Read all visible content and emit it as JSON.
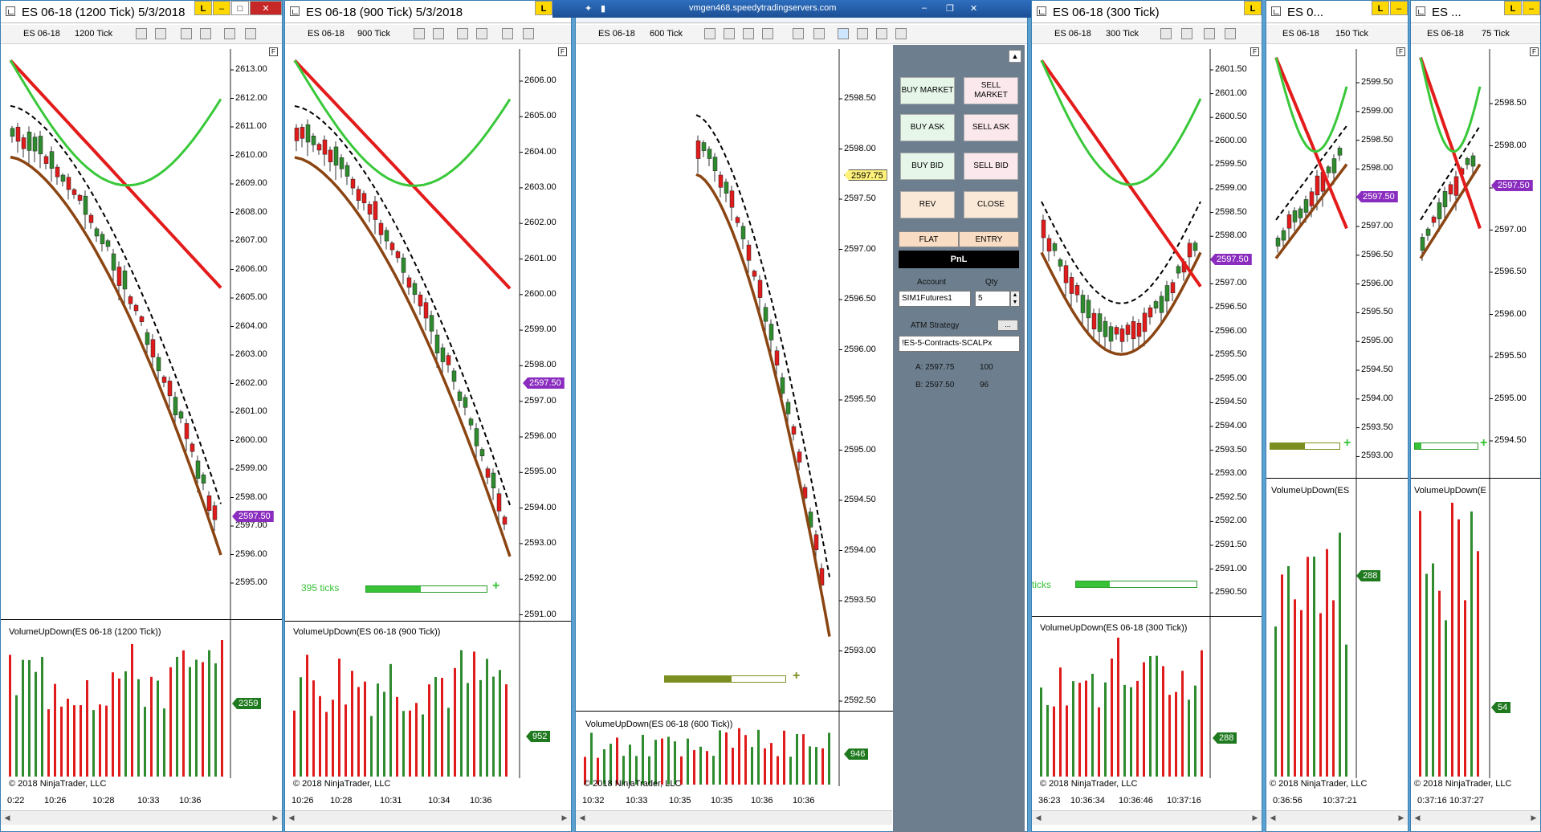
{
  "windows": [
    {
      "id": "w1200",
      "title": "ES 06-18 (1200 Tick)  5/3/2018",
      "instrument": "ES 06-18",
      "interval": "1200 Tick",
      "price_badge": "2597.50",
      "volume_title": "VolumeUpDown(ES 06-18 (1200 Tick))",
      "volume_badge": "2359",
      "copyright": "© 2018 NinjaTrader, LLC",
      "yticks": [
        "2613.00",
        "2612.00",
        "2611.00",
        "2610.00",
        "2609.00",
        "2608.00",
        "2607.00",
        "2606.00",
        "2605.00",
        "2604.00",
        "2603.00",
        "2602.00",
        "2601.00",
        "2600.00",
        "2599.00",
        "2598.00",
        "2597.00",
        "2596.00",
        "2595.00"
      ],
      "xticks": [
        "0:22",
        "10:26",
        "10:28",
        "10:33",
        "10:36"
      ]
    },
    {
      "id": "w900",
      "title": "ES 06-18 (900 Tick)  5/3/2018",
      "instrument": "ES 06-18",
      "interval": "900 Tick",
      "price_badge": "2597.50",
      "volume_title": "VolumeUpDown(ES 06-18 (900 Tick))",
      "volume_badge": "952",
      "copyright": "© 2018 NinjaTrader, LLC",
      "ticks_left": "395 ticks",
      "yticks": [
        "2606.00",
        "2605.00",
        "2604.00",
        "2603.00",
        "2602.00",
        "2601.00",
        "2600.00",
        "2599.00",
        "2598.00",
        "2597.00",
        "2596.00",
        "2595.00",
        "2594.00",
        "2593.00",
        "2592.00",
        "2591.00"
      ],
      "xticks": [
        "10:26",
        "10:28",
        "10:31",
        "10:34",
        "10:36"
      ]
    },
    {
      "id": "w600",
      "title": "",
      "instrument": "ES 06-18",
      "interval": "600 Tick",
      "price_badge": "2597.75",
      "volume_title": "VolumeUpDown(ES 06-18 (600 Tick))",
      "volume_badge": "946",
      "copyright": "© 2018 NinjaTrader, LLC",
      "yticks": [
        "2598.50",
        "2598.00",
        "2597.50",
        "2597.00",
        "2596.50",
        "2596.00",
        "2595.50",
        "2595.00",
        "2594.50",
        "2594.00",
        "2593.50",
        "2593.00",
        "2592.50"
      ],
      "xticks": [
        "10:32",
        "10:33",
        "10:35",
        "10:35",
        "10:36",
        "10:36"
      ]
    },
    {
      "id": "w300",
      "title": "ES 06-18 (300 Tick)",
      "instrument": "ES 06-18",
      "interval": "300 Tick",
      "price_badge": "2597.50",
      "volume_title": "VolumeUpDown(ES 06-18 (300 Tick))",
      "volume_badge": "288",
      "copyright": "© 2018 NinjaTrader, LLC",
      "ticks_left": "ticks",
      "yticks": [
        "2601.50",
        "2601.00",
        "2600.50",
        "2600.00",
        "2599.50",
        "2599.00",
        "2598.50",
        "2598.00",
        "2597.50",
        "2597.00",
        "2596.50",
        "2596.00",
        "2595.50",
        "2595.00",
        "2594.50",
        "2594.00",
        "2593.50",
        "2593.00",
        "2592.50",
        "2592.00",
        "2591.50",
        "2591.00",
        "2590.50"
      ],
      "xticks": [
        "36:23",
        "10:36:34",
        "10:36:46",
        "10:37:16"
      ]
    },
    {
      "id": "w150",
      "title": "ES 0...",
      "instrument": "ES 06-18",
      "interval": "150 Tick",
      "price_badge": "2597.50",
      "volume_title": "VolumeUpDown(ES",
      "volume_badge": "288",
      "copyright": "© 2018 NinjaTrader, LLC",
      "yticks": [
        "2599.50",
        "2599.00",
        "2598.50",
        "2598.00",
        "2597.50",
        "2597.00",
        "2596.50",
        "2596.00",
        "2595.50",
        "2595.00",
        "2594.50",
        "2594.00",
        "2593.50",
        "2593.00"
      ],
      "xticks": [
        "0:36:56",
        "10:37:21"
      ]
    },
    {
      "id": "w75",
      "title": "ES ...",
      "instrument": "ES 06-18",
      "interval": "75 Tick",
      "price_badge": "2597.50",
      "volume_title": "VolumeUpDown(E",
      "volume_badge": "54",
      "copyright": "© 2018 NinjaTrader, LLC",
      "yticks": [
        "2598.50",
        "2598.00",
        "2597.50",
        "2597.00",
        "2596.50",
        "2596.00",
        "2595.50",
        "2595.00",
        "2594.50"
      ],
      "xticks": [
        "0:37:16",
        "10:37:27"
      ]
    }
  ],
  "remote_title": "vmgen468.speedytradingservers.com",
  "trader": {
    "buy_market": "BUY MARKET",
    "sell_market": "SELL MARKET",
    "buy_ask": "BUY ASK",
    "sell_ask": "SELL ASK",
    "buy_bid": "BUY BID",
    "sell_bid": "SELL BID",
    "rev": "REV",
    "close": "CLOSE",
    "flat": "FLAT",
    "entry": "ENTRY",
    "pnl": "PnL",
    "account_label": "Account",
    "qty_label": "Qty",
    "account_value": "SIM1Futures1",
    "qty_value": "5",
    "atm_label": "ATM Strategy",
    "atm_more": "...",
    "atm_value": "!ES-5-Contracts-SCALPx",
    "ask_label": "A: 2597.75",
    "ask_size": "100",
    "bid_label": "B: 2597.50",
    "bid_size": "96"
  },
  "colors": {
    "up_bar": "#2e8b2e",
    "down_bar": "#e01b1b",
    "sma_red": "#e31b1b",
    "sma_green": "#39c839",
    "band_brown": "#8b4513",
    "dash_black": "#000000",
    "badge_purple": "#8a2dbf"
  }
}
